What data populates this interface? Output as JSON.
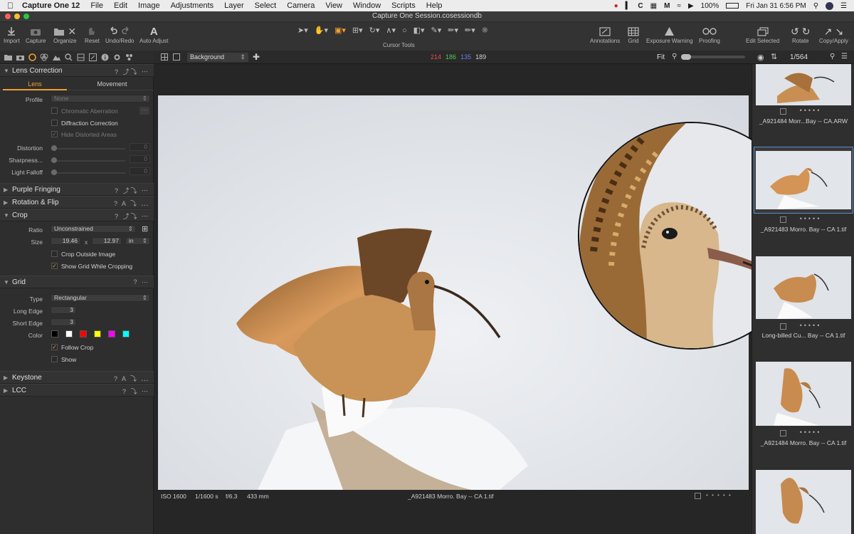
{
  "menubar": {
    "app": "Capture One 12",
    "items": [
      "File",
      "Edit",
      "Image",
      "Adjustments",
      "Layer",
      "Select",
      "Camera",
      "View",
      "Window",
      "Scripts",
      "Help"
    ],
    "battery": "100%",
    "datetime": "Fri Jan 31  6:56 PM"
  },
  "window": {
    "title": "Capture One Session.cosessiondb"
  },
  "toolbar": {
    "import": "Import",
    "capture": "Capture",
    "organize": "Organize",
    "reset": "Reset",
    "undo_redo": "Undo/Redo",
    "auto_adjust": "Auto Adjust",
    "cursor_tools": "Cursor Tools",
    "annotations": "Annotations",
    "grid": "Grid",
    "exposure_warning": "Exposure Warning",
    "proofing": "Proofing",
    "edit_selected": "Edit Selected",
    "rotate": "Rotate",
    "copy_apply": "Copy/Apply"
  },
  "viewerbar": {
    "background": "Background",
    "rgb": {
      "r": "214",
      "g": "186",
      "b": "135",
      "l": "189"
    },
    "zoom": "Fit"
  },
  "browserbar": {
    "count": "1/564"
  },
  "lens": {
    "title": "Lens Correction",
    "tab_lens": "Lens",
    "tab_movement": "Movement",
    "profile_label": "Profile",
    "profile_value": "None",
    "chromatic": "Chromatic Aberration",
    "diffraction": "Diffraction Correction",
    "hide_distorted": "Hide Distorted Areas",
    "distortion": "Distortion",
    "sharpness": "Sharpness...",
    "light_falloff": "Light Falloff",
    "distortion_val": "0",
    "sharpness_val": "0",
    "light_falloff_val": "0"
  },
  "purple": {
    "title": "Purple Fringing"
  },
  "rotation": {
    "title": "Rotation & Flip"
  },
  "crop": {
    "title": "Crop",
    "ratio_label": "Ratio",
    "ratio_value": "Unconstrained",
    "size_label": "Size",
    "width": "19.46",
    "x": "x",
    "height": "12.97",
    "unit": "in",
    "outside": "Crop Outside Image",
    "show_grid": "Show Grid While Cropping"
  },
  "grid": {
    "title": "Grid",
    "type_label": "Type",
    "type_value": "Rectangular",
    "long_label": "Long Edge",
    "long_value": "3",
    "short_label": "Short Edge",
    "short_value": "3",
    "color_label": "Color",
    "colors": [
      "#000000",
      "#ffffff",
      "#ff0000",
      "#ffff00",
      "#ff00ff",
      "#00ffff"
    ],
    "follow": "Follow Crop",
    "show": "Show"
  },
  "keystone": {
    "title": "Keystone"
  },
  "lcc": {
    "title": "LCC"
  },
  "status": {
    "iso": "ISO 1600",
    "shutter": "1/1600 s",
    "aperture": "f/6.3",
    "focal": "433 mm",
    "filename": "_A921483 Morro. Bay -- CA 1.tif"
  },
  "thumbnails": [
    {
      "caption": "_A921484 Morr...Bay -- CA.ARW"
    },
    {
      "caption": "_A921483 Morro. Bay -- CA 1.tif"
    },
    {
      "caption": "Long-billed Cu... Bay -- CA 1.tif"
    },
    {
      "caption": "_A921484 Morro. Bay -- CA 1.tif"
    }
  ],
  "accent": "#f0a030",
  "selection": "#5a8fd0"
}
